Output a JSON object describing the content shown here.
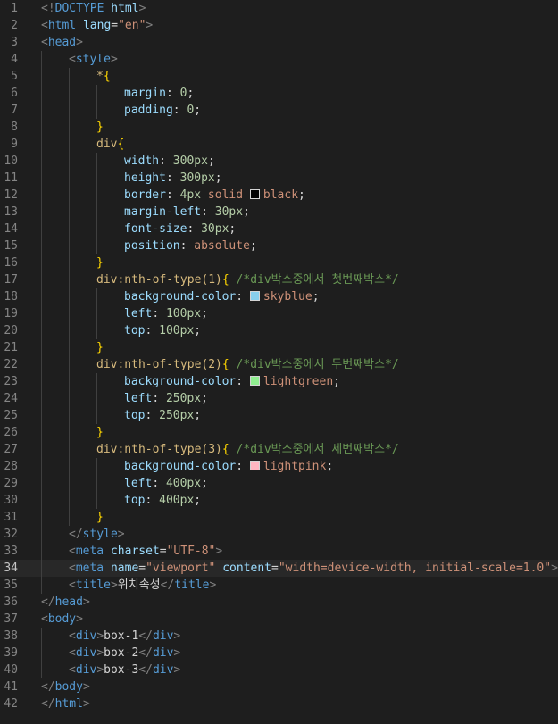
{
  "editor": {
    "current_line": 34,
    "colors": {
      "background": "#1e1e1e",
      "tag": "#569cd6",
      "attribute": "#9cdcfe",
      "string": "#ce9178",
      "selector": "#d7ba7d",
      "number": "#b5cea8",
      "comment": "#6a9955"
    },
    "lines": [
      {
        "n": "1",
        "indent": 0,
        "tokens": [
          {
            "t": "<!",
            "c": "t-punct"
          },
          {
            "t": "DOCTYPE",
            "c": "t-kw"
          },
          {
            "t": " html",
            "c": "t-attr"
          },
          {
            "t": ">",
            "c": "t-punct"
          }
        ]
      },
      {
        "n": "2",
        "indent": 0,
        "tokens": [
          {
            "t": "<",
            "c": "t-punct"
          },
          {
            "t": "html",
            "c": "t-tag"
          },
          {
            "t": " lang",
            "c": "t-attr"
          },
          {
            "t": "=",
            "c": "t-plain"
          },
          {
            "t": "\"en\"",
            "c": "t-str"
          },
          {
            "t": ">",
            "c": "t-punct"
          }
        ]
      },
      {
        "n": "3",
        "indent": 0,
        "tokens": [
          {
            "t": "<",
            "c": "t-punct"
          },
          {
            "t": "head",
            "c": "t-tag"
          },
          {
            "t": ">",
            "c": "t-punct"
          }
        ]
      },
      {
        "n": "4",
        "indent": 1,
        "tokens": [
          {
            "t": "<",
            "c": "t-punct"
          },
          {
            "t": "style",
            "c": "t-tag"
          },
          {
            "t": ">",
            "c": "t-punct"
          }
        ]
      },
      {
        "n": "5",
        "indent": 2,
        "tokens": [
          {
            "t": "*",
            "c": "t-sel"
          },
          {
            "t": "{",
            "c": "t-brace"
          }
        ]
      },
      {
        "n": "6",
        "indent": 3,
        "tokens": [
          {
            "t": "margin",
            "c": "t-prop"
          },
          {
            "t": ": ",
            "c": "t-plain"
          },
          {
            "t": "0",
            "c": "t-num"
          },
          {
            "t": ";",
            "c": "t-plain"
          }
        ]
      },
      {
        "n": "7",
        "indent": 3,
        "tokens": [
          {
            "t": "padding",
            "c": "t-prop"
          },
          {
            "t": ": ",
            "c": "t-plain"
          },
          {
            "t": "0",
            "c": "t-num"
          },
          {
            "t": ";",
            "c": "t-plain"
          }
        ]
      },
      {
        "n": "8",
        "indent": 2,
        "tokens": [
          {
            "t": "}",
            "c": "t-brace"
          }
        ]
      },
      {
        "n": "9",
        "indent": 2,
        "tokens": [
          {
            "t": "div",
            "c": "t-sel"
          },
          {
            "t": "{",
            "c": "t-brace"
          }
        ]
      },
      {
        "n": "10",
        "indent": 3,
        "tokens": [
          {
            "t": "width",
            "c": "t-prop"
          },
          {
            "t": ": ",
            "c": "t-plain"
          },
          {
            "t": "300px",
            "c": "t-num"
          },
          {
            "t": ";",
            "c": "t-plain"
          }
        ]
      },
      {
        "n": "11",
        "indent": 3,
        "tokens": [
          {
            "t": "height",
            "c": "t-prop"
          },
          {
            "t": ": ",
            "c": "t-plain"
          },
          {
            "t": "300px",
            "c": "t-num"
          },
          {
            "t": ";",
            "c": "t-plain"
          }
        ]
      },
      {
        "n": "12",
        "indent": 3,
        "tokens": [
          {
            "t": "border",
            "c": "t-prop"
          },
          {
            "t": ": ",
            "c": "t-plain"
          },
          {
            "t": "4px",
            "c": "t-num"
          },
          {
            "t": " solid ",
            "c": "t-val"
          },
          {
            "swatch": "#000000"
          },
          {
            "t": "black",
            "c": "t-val"
          },
          {
            "t": ";",
            "c": "t-plain"
          }
        ]
      },
      {
        "n": "13",
        "indent": 3,
        "tokens": [
          {
            "t": "margin-left",
            "c": "t-prop"
          },
          {
            "t": ": ",
            "c": "t-plain"
          },
          {
            "t": "30px",
            "c": "t-num"
          },
          {
            "t": ";",
            "c": "t-plain"
          }
        ]
      },
      {
        "n": "14",
        "indent": 3,
        "tokens": [
          {
            "t": "font-size",
            "c": "t-prop"
          },
          {
            "t": ": ",
            "c": "t-plain"
          },
          {
            "t": "30px",
            "c": "t-num"
          },
          {
            "t": ";",
            "c": "t-plain"
          }
        ]
      },
      {
        "n": "15",
        "indent": 3,
        "tokens": [
          {
            "t": "position",
            "c": "t-prop"
          },
          {
            "t": ": ",
            "c": "t-plain"
          },
          {
            "t": "absolute",
            "c": "t-val"
          },
          {
            "t": ";",
            "c": "t-plain"
          }
        ]
      },
      {
        "n": "16",
        "indent": 2,
        "tokens": [
          {
            "t": "}",
            "c": "t-brace"
          }
        ]
      },
      {
        "n": "17",
        "indent": 2,
        "tokens": [
          {
            "t": "div:nth-of-type(1)",
            "c": "t-sel"
          },
          {
            "t": "{",
            "c": "t-brace"
          },
          {
            "t": " /*div박스중에서 첫번째박스*/",
            "c": "t-cmt"
          }
        ]
      },
      {
        "n": "18",
        "indent": 3,
        "tokens": [
          {
            "t": "background-color",
            "c": "t-prop"
          },
          {
            "t": ": ",
            "c": "t-plain"
          },
          {
            "swatch": "#87ceeb"
          },
          {
            "t": "skyblue",
            "c": "t-val"
          },
          {
            "t": ";",
            "c": "t-plain"
          }
        ]
      },
      {
        "n": "19",
        "indent": 3,
        "tokens": [
          {
            "t": "left",
            "c": "t-prop"
          },
          {
            "t": ": ",
            "c": "t-plain"
          },
          {
            "t": "100px",
            "c": "t-num"
          },
          {
            "t": ";",
            "c": "t-plain"
          }
        ]
      },
      {
        "n": "20",
        "indent": 3,
        "tokens": [
          {
            "t": "top",
            "c": "t-prop"
          },
          {
            "t": ": ",
            "c": "t-plain"
          },
          {
            "t": "100px",
            "c": "t-num"
          },
          {
            "t": ";",
            "c": "t-plain"
          }
        ]
      },
      {
        "n": "21",
        "indent": 2,
        "tokens": [
          {
            "t": "}",
            "c": "t-brace"
          }
        ]
      },
      {
        "n": "22",
        "indent": 2,
        "tokens": [
          {
            "t": "div:nth-of-type(2)",
            "c": "t-sel"
          },
          {
            "t": "{",
            "c": "t-brace"
          },
          {
            "t": " /*div박스중에서 두번째박스*/",
            "c": "t-cmt"
          }
        ]
      },
      {
        "n": "23",
        "indent": 3,
        "tokens": [
          {
            "t": "background-color",
            "c": "t-prop"
          },
          {
            "t": ": ",
            "c": "t-plain"
          },
          {
            "swatch": "#90ee90"
          },
          {
            "t": "lightgreen",
            "c": "t-val"
          },
          {
            "t": ";",
            "c": "t-plain"
          }
        ]
      },
      {
        "n": "24",
        "indent": 3,
        "tokens": [
          {
            "t": "left",
            "c": "t-prop"
          },
          {
            "t": ": ",
            "c": "t-plain"
          },
          {
            "t": "250px",
            "c": "t-num"
          },
          {
            "t": ";",
            "c": "t-plain"
          }
        ]
      },
      {
        "n": "25",
        "indent": 3,
        "tokens": [
          {
            "t": "top",
            "c": "t-prop"
          },
          {
            "t": ": ",
            "c": "t-plain"
          },
          {
            "t": "250px",
            "c": "t-num"
          },
          {
            "t": ";",
            "c": "t-plain"
          }
        ]
      },
      {
        "n": "26",
        "indent": 2,
        "tokens": [
          {
            "t": "}",
            "c": "t-brace"
          }
        ]
      },
      {
        "n": "27",
        "indent": 2,
        "tokens": [
          {
            "t": "div:nth-of-type(3)",
            "c": "t-sel"
          },
          {
            "t": "{",
            "c": "t-brace"
          },
          {
            "t": " /*div박스중에서 세번째박스*/",
            "c": "t-cmt"
          }
        ]
      },
      {
        "n": "28",
        "indent": 3,
        "tokens": [
          {
            "t": "background-color",
            "c": "t-prop"
          },
          {
            "t": ": ",
            "c": "t-plain"
          },
          {
            "swatch": "#ffb6c1"
          },
          {
            "t": "lightpink",
            "c": "t-val"
          },
          {
            "t": ";",
            "c": "t-plain"
          }
        ]
      },
      {
        "n": "29",
        "indent": 3,
        "tokens": [
          {
            "t": "left",
            "c": "t-prop"
          },
          {
            "t": ": ",
            "c": "t-plain"
          },
          {
            "t": "400px",
            "c": "t-num"
          },
          {
            "t": ";",
            "c": "t-plain"
          }
        ]
      },
      {
        "n": "30",
        "indent": 3,
        "tokens": [
          {
            "t": "top",
            "c": "t-prop"
          },
          {
            "t": ": ",
            "c": "t-plain"
          },
          {
            "t": "400px",
            "c": "t-num"
          },
          {
            "t": ";",
            "c": "t-plain"
          }
        ]
      },
      {
        "n": "31",
        "indent": 2,
        "tokens": [
          {
            "t": "}",
            "c": "t-brace"
          }
        ]
      },
      {
        "n": "32",
        "indent": 1,
        "tokens": [
          {
            "t": "</",
            "c": "t-punct"
          },
          {
            "t": "style",
            "c": "t-tag"
          },
          {
            "t": ">",
            "c": "t-punct"
          }
        ]
      },
      {
        "n": "33",
        "indent": 1,
        "tokens": [
          {
            "t": "<",
            "c": "t-punct"
          },
          {
            "t": "meta",
            "c": "t-tag"
          },
          {
            "t": " charset",
            "c": "t-attr"
          },
          {
            "t": "=",
            "c": "t-plain"
          },
          {
            "t": "\"UTF-8\"",
            "c": "t-str"
          },
          {
            "t": ">",
            "c": "t-punct"
          }
        ]
      },
      {
        "n": "34",
        "indent": 1,
        "tokens": [
          {
            "t": "<",
            "c": "t-punct"
          },
          {
            "t": "meta",
            "c": "t-tag"
          },
          {
            "t": " name",
            "c": "t-attr"
          },
          {
            "t": "=",
            "c": "t-plain"
          },
          {
            "t": "\"viewport\"",
            "c": "t-str"
          },
          {
            "t": " content",
            "c": "t-attr"
          },
          {
            "t": "=",
            "c": "t-plain"
          },
          {
            "t": "\"width=device-width, initial-scale=1.0\"",
            "c": "t-str"
          },
          {
            "t": ">",
            "c": "t-punct"
          }
        ]
      },
      {
        "n": "35",
        "indent": 1,
        "tokens": [
          {
            "t": "<",
            "c": "t-punct"
          },
          {
            "t": "title",
            "c": "t-tag"
          },
          {
            "t": ">",
            "c": "t-punct"
          },
          {
            "t": "위치속성",
            "c": "t-text"
          },
          {
            "t": "</",
            "c": "t-punct"
          },
          {
            "t": "title",
            "c": "t-tag"
          },
          {
            "t": ">",
            "c": "t-punct"
          }
        ]
      },
      {
        "n": "36",
        "indent": 0,
        "tokens": [
          {
            "t": "</",
            "c": "t-punct"
          },
          {
            "t": "head",
            "c": "t-tag"
          },
          {
            "t": ">",
            "c": "t-punct"
          }
        ]
      },
      {
        "n": "37",
        "indent": 0,
        "tokens": [
          {
            "t": "<",
            "c": "t-punct"
          },
          {
            "t": "body",
            "c": "t-tag"
          },
          {
            "t": ">",
            "c": "t-punct"
          }
        ]
      },
      {
        "n": "38",
        "indent": 1,
        "tokens": [
          {
            "t": "<",
            "c": "t-punct"
          },
          {
            "t": "div",
            "c": "t-tag"
          },
          {
            "t": ">",
            "c": "t-punct"
          },
          {
            "t": "box-1",
            "c": "t-text"
          },
          {
            "t": "</",
            "c": "t-punct"
          },
          {
            "t": "div",
            "c": "t-tag"
          },
          {
            "t": ">",
            "c": "t-punct"
          }
        ]
      },
      {
        "n": "39",
        "indent": 1,
        "tokens": [
          {
            "t": "<",
            "c": "t-punct"
          },
          {
            "t": "div",
            "c": "t-tag"
          },
          {
            "t": ">",
            "c": "t-punct"
          },
          {
            "t": "box-2",
            "c": "t-text"
          },
          {
            "t": "</",
            "c": "t-punct"
          },
          {
            "t": "div",
            "c": "t-tag"
          },
          {
            "t": ">",
            "c": "t-punct"
          }
        ]
      },
      {
        "n": "40",
        "indent": 1,
        "tokens": [
          {
            "t": "<",
            "c": "t-punct"
          },
          {
            "t": "div",
            "c": "t-tag"
          },
          {
            "t": ">",
            "c": "t-punct"
          },
          {
            "t": "box-3",
            "c": "t-text"
          },
          {
            "t": "</",
            "c": "t-punct"
          },
          {
            "t": "div",
            "c": "t-tag"
          },
          {
            "t": ">",
            "c": "t-punct"
          }
        ]
      },
      {
        "n": "41",
        "indent": 0,
        "tokens": [
          {
            "t": "</",
            "c": "t-punct"
          },
          {
            "t": "body",
            "c": "t-tag"
          },
          {
            "t": ">",
            "c": "t-punct"
          }
        ]
      },
      {
        "n": "42",
        "indent": 0,
        "tokens": [
          {
            "t": "</",
            "c": "t-punct"
          },
          {
            "t": "html",
            "c": "t-tag"
          },
          {
            "t": ">",
            "c": "t-punct"
          }
        ]
      }
    ]
  }
}
